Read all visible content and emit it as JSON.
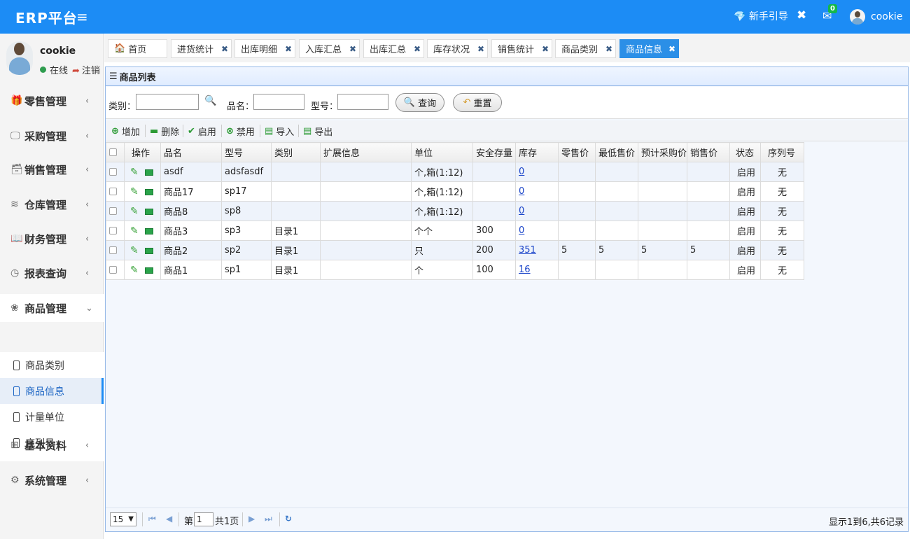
{
  "header": {
    "brand": "ERP平台",
    "menu_icon": "≡",
    "guide_label": "新手引导",
    "guide_icon": "diamond-icon",
    "fullscreen_icon": "expand-icon",
    "mail_icon": "envelope-icon",
    "mail_badge": "0",
    "username": "cookie"
  },
  "sidebar": {
    "user": {
      "name": "cookie",
      "status": "在线",
      "logout": "注销"
    },
    "items": [
      {
        "label": "零售管理",
        "icon": "gift-icon",
        "glyph": "🎁"
      },
      {
        "label": "采购管理",
        "icon": "monitor-icon",
        "glyph": "🖵"
      },
      {
        "label": "销售管理",
        "icon": "briefcase-icon",
        "glyph": "🗃"
      },
      {
        "label": "仓库管理",
        "icon": "layers-icon",
        "glyph": "≋"
      },
      {
        "label": "财务管理",
        "icon": "book-icon",
        "glyph": "📖"
      },
      {
        "label": "报表查询",
        "icon": "clock-icon",
        "glyph": "◷"
      },
      {
        "label": "商品管理",
        "icon": "box-icon",
        "glyph": "❀"
      },
      {
        "label": "基本资料",
        "icon": "grid-icon",
        "glyph": "⊞"
      },
      {
        "label": "系统管理",
        "icon": "gear-icon",
        "glyph": "⚙"
      }
    ],
    "sub_items": [
      {
        "label": "商品类别"
      },
      {
        "label": "商品信息"
      },
      {
        "label": "计量单位"
      },
      {
        "label": "序列号"
      }
    ]
  },
  "tabs": [
    {
      "label": "首页"
    },
    {
      "label": "进货统计"
    },
    {
      "label": "出库明细"
    },
    {
      "label": "入库汇总"
    },
    {
      "label": "出库汇总"
    },
    {
      "label": "库存状况"
    },
    {
      "label": "销售统计"
    },
    {
      "label": "商品类别"
    },
    {
      "label": "商品信息"
    }
  ],
  "panel": {
    "title": "商品列表"
  },
  "search": {
    "category_label": "类别：",
    "name_label": "品名：",
    "model_label": "型号：",
    "category_value": "",
    "name_value": "",
    "model_value": "",
    "query_button": "查询",
    "reset_button": "重置"
  },
  "toolbar": {
    "add": "增加",
    "delete": "删除",
    "enable": "启用",
    "disable": "禁用",
    "import": "导入",
    "export": "导出"
  },
  "table": {
    "columns": [
      "",
      "操作",
      "品名",
      "型号",
      "类别",
      "扩展信息",
      "单位",
      "安全存量",
      "库存",
      "零售价",
      "最低售价",
      "预计采购价",
      "销售价",
      "状态",
      "序列号"
    ],
    "rows": [
      {
        "name": "asdf",
        "model": "adsfasdf",
        "category": "",
        "ext": "",
        "unit": "个,箱(1:12)",
        "safety": "",
        "stock": "0",
        "retail": "",
        "min": "",
        "purchase": "",
        "sale": "",
        "status": "启用",
        "serial": "无"
      },
      {
        "name": "商品17",
        "model": "sp17",
        "category": "",
        "ext": "",
        "unit": "个,箱(1:12)",
        "safety": "",
        "stock": "0",
        "retail": "",
        "min": "",
        "purchase": "",
        "sale": "",
        "status": "启用",
        "serial": "无"
      },
      {
        "name": "商品8",
        "model": "sp8",
        "category": "",
        "ext": "",
        "unit": "个,箱(1:12)",
        "safety": "",
        "stock": "0",
        "retail": "",
        "min": "",
        "purchase": "",
        "sale": "",
        "status": "启用",
        "serial": "无"
      },
      {
        "name": "商品3",
        "model": "sp3",
        "category": "目录1",
        "ext": "",
        "unit": "个个",
        "safety": "300",
        "stock": "0",
        "retail": "",
        "min": "",
        "purchase": "",
        "sale": "",
        "status": "启用",
        "serial": "无"
      },
      {
        "name": "商品2",
        "model": "sp2",
        "category": "目录1",
        "ext": "",
        "unit": "只",
        "safety": "200",
        "stock": "351",
        "retail": "5",
        "min": "5",
        "purchase": "5",
        "sale": "5",
        "status": "启用",
        "serial": "无"
      },
      {
        "name": "商品1",
        "model": "sp1",
        "category": "目录1",
        "ext": "",
        "unit": "个",
        "safety": "100",
        "stock": "16",
        "retail": "",
        "min": "",
        "purchase": "",
        "sale": "",
        "status": "启用",
        "serial": "无"
      }
    ]
  },
  "pager": {
    "page_size": "15",
    "page_prefix": "第",
    "page_number": "1",
    "page_total": "共1页",
    "info": "显示1到6,共6记录"
  },
  "colors": {
    "header_bg": "#1c8cf5",
    "active_tab": "#2b8fe7",
    "link": "#1a44c9"
  }
}
